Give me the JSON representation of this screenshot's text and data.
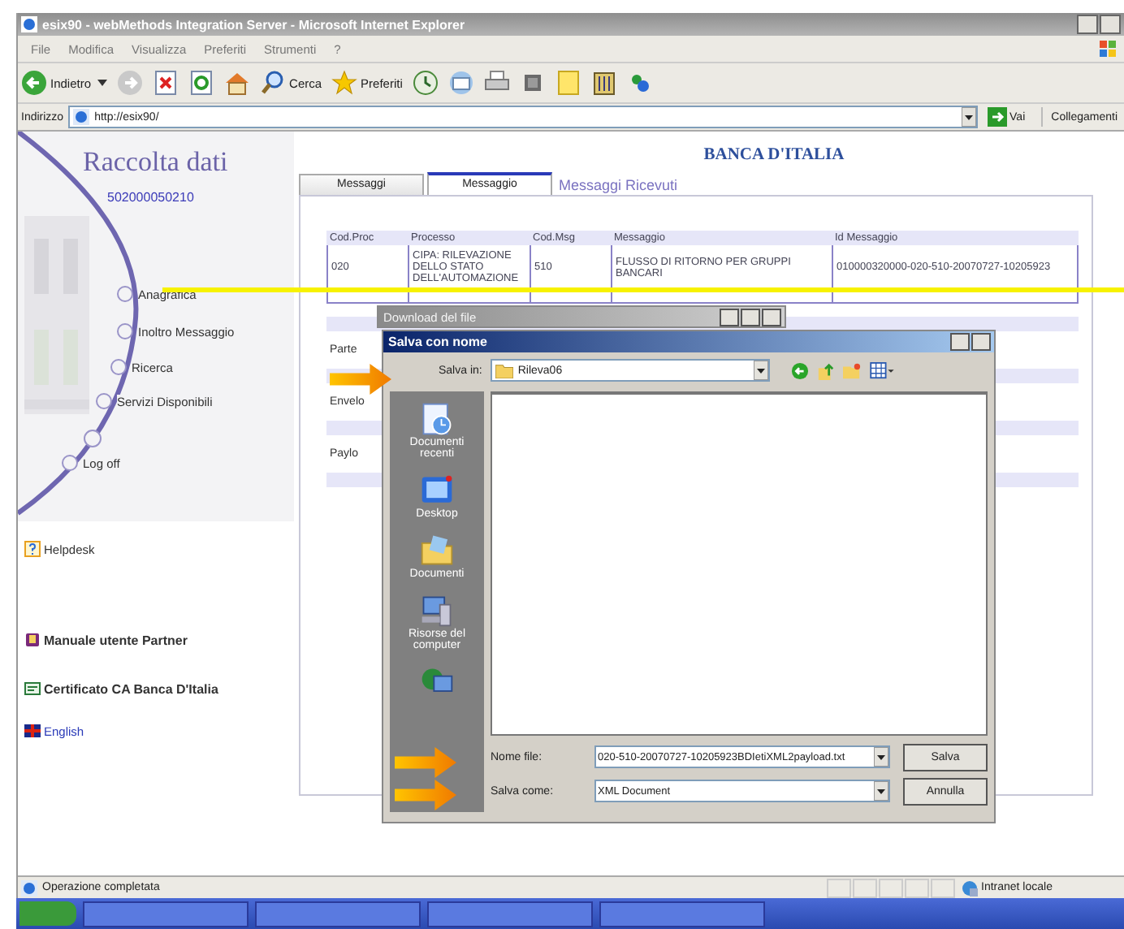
{
  "window": {
    "title": "esix90 - webMethods Integration Server - Microsoft Internet Explorer"
  },
  "menu": [
    "File",
    "Modifica",
    "Visualizza",
    "Preferiti",
    "Strumenti",
    "?"
  ],
  "toolbar": [
    {
      "kind": "back",
      "label": "Indietro"
    },
    {
      "kind": "forward"
    },
    {
      "kind": "stop"
    },
    {
      "kind": "refresh"
    },
    {
      "kind": "home"
    },
    {
      "kind": "search",
      "label": "Cerca"
    },
    {
      "kind": "favorites",
      "label": "Preferiti"
    },
    {
      "kind": "history"
    },
    {
      "kind": "mail"
    },
    {
      "kind": "print"
    },
    {
      "kind": "edit"
    },
    {
      "kind": "note"
    },
    {
      "kind": "tool"
    },
    {
      "kind": "messenger"
    }
  ],
  "address": {
    "label": "Indirizzo",
    "value": "http://esix90/",
    "go": "Vai",
    "links": "Collegamenti"
  },
  "sidebar": {
    "title": "Raccolta dati",
    "code": "502000050210",
    "nav": [
      "Anagrafica",
      "Inoltro Messaggio",
      "Ricerca",
      "Servizi Disponibili",
      "Log off"
    ],
    "links": [
      {
        "kind": "help",
        "label": "Helpdesk"
      },
      {
        "kind": "book",
        "label": "Manuale utente Partner"
      },
      {
        "kind": "certificate",
        "label": "Certificato CA Banca D'Italia"
      },
      {
        "kind": "flag",
        "label": "English"
      }
    ]
  },
  "header": "BANCA D'ITALIA",
  "tabs": [
    {
      "label": "Messaggi",
      "kind": "tab",
      "selected": false
    },
    {
      "label": "Messaggio",
      "kind": "tab",
      "selected": true
    },
    {
      "label": "Messaggi Ricevuti",
      "kind": "link",
      "selected": false
    }
  ],
  "table": {
    "columns": [
      "Cod.Proc",
      "Processo",
      "Cod.Msg",
      "Messaggio",
      "Id Messaggio"
    ],
    "rows": [
      [
        "020",
        "CIPA: RILEVAZIONE DELLO STATO DELL'AUTOMAZIONE",
        "510",
        "FLUSSO DI RITORNO PER GRUPPI BANCARI",
        "010000320000-020-510-20070727-10205923"
      ]
    ]
  },
  "parts": [
    "Parte",
    "Envelo",
    "Paylo"
  ],
  "download_dialog": {
    "title": "Download del file"
  },
  "save_dialog": {
    "title": "Salva con nome",
    "save_in_label": "Salva in:",
    "folder": "Rileva06",
    "places": [
      {
        "kind": "recent",
        "label": "Documenti recenti"
      },
      {
        "kind": "desktop",
        "label": "Desktop"
      },
      {
        "kind": "documents",
        "label": "Documenti"
      },
      {
        "kind": "computer",
        "label": "Risorse del computer"
      },
      {
        "kind": "network"
      }
    ],
    "filename_label": "Nome file:",
    "filename": "020-510-20070727-10205923BDIetiXML2payload.txt",
    "type_label": "Salva come:",
    "type": "XML Document",
    "buttons": [
      "Salva",
      "Annulla"
    ]
  },
  "status_bar": {
    "text": "Operazione completata",
    "zone": "Intranet locale"
  }
}
